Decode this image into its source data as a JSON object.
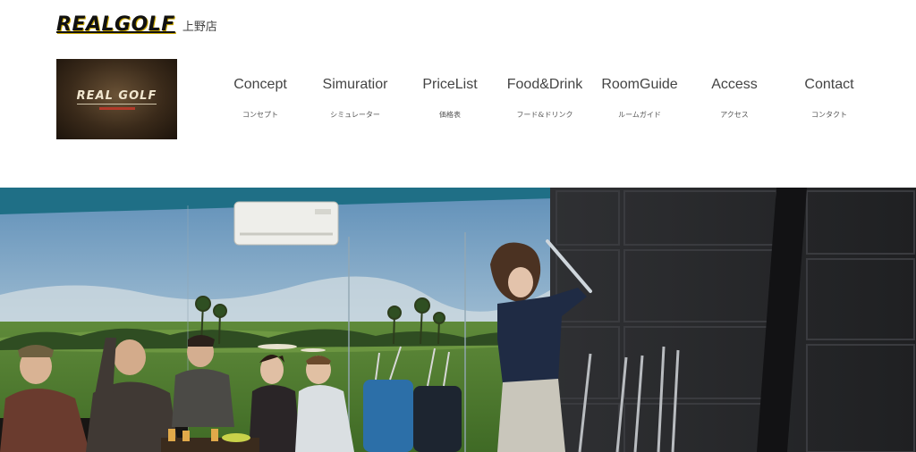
{
  "brand": {
    "name": "REALGOLF",
    "branch": "上野店"
  },
  "store_photo": {
    "sign_text": "REAL GOLF"
  },
  "nav": {
    "items": [
      {
        "en": "Concept",
        "jp": "コンセプト"
      },
      {
        "en": "Simuratior",
        "jp": "シミュレーター"
      },
      {
        "en": "PriceList",
        "jp": "価格表"
      },
      {
        "en": "Food&Drink",
        "jp": "フード&ドリンク"
      },
      {
        "en": "RoomGuide",
        "jp": "ルームガイド"
      },
      {
        "en": "Access",
        "jp": "アクセス"
      },
      {
        "en": "Contact",
        "jp": "コンタクト"
      }
    ]
  },
  "hero": {
    "scene": "golf-simulator-room"
  }
}
